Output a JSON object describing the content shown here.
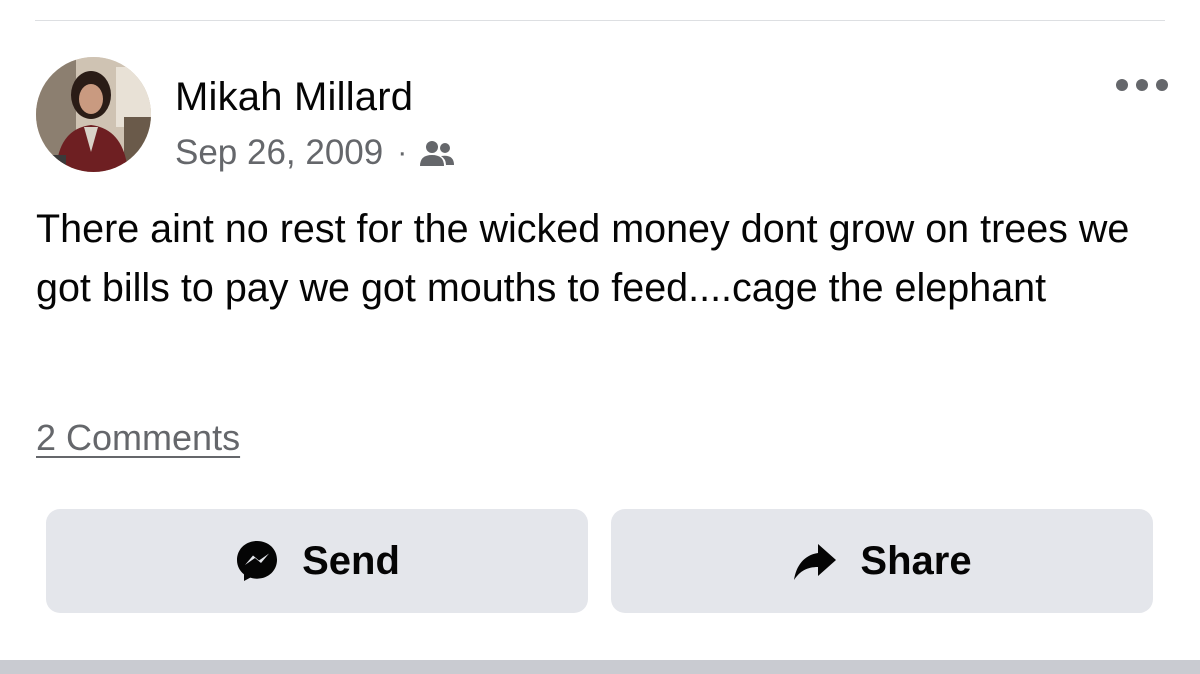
{
  "post": {
    "author": "Mikah Millard",
    "date": "Sep 26, 2009",
    "separator": "·",
    "audience_icon": "friends-icon",
    "text": "There aint no rest for the wicked money dont grow on trees we got bills to pay we got mouths to feed....cage the elephant",
    "comments_label": "2 Comments",
    "more_icon": "more-options-icon"
  },
  "actions": {
    "send_label": "Send",
    "send_icon": "messenger-icon",
    "share_label": "Share",
    "share_icon": "share-arrow-icon"
  },
  "colors": {
    "text_primary": "#050505",
    "text_secondary": "#65676b",
    "button_bg": "#e4e6eb",
    "bottom_bar": "#c9cbd1"
  }
}
